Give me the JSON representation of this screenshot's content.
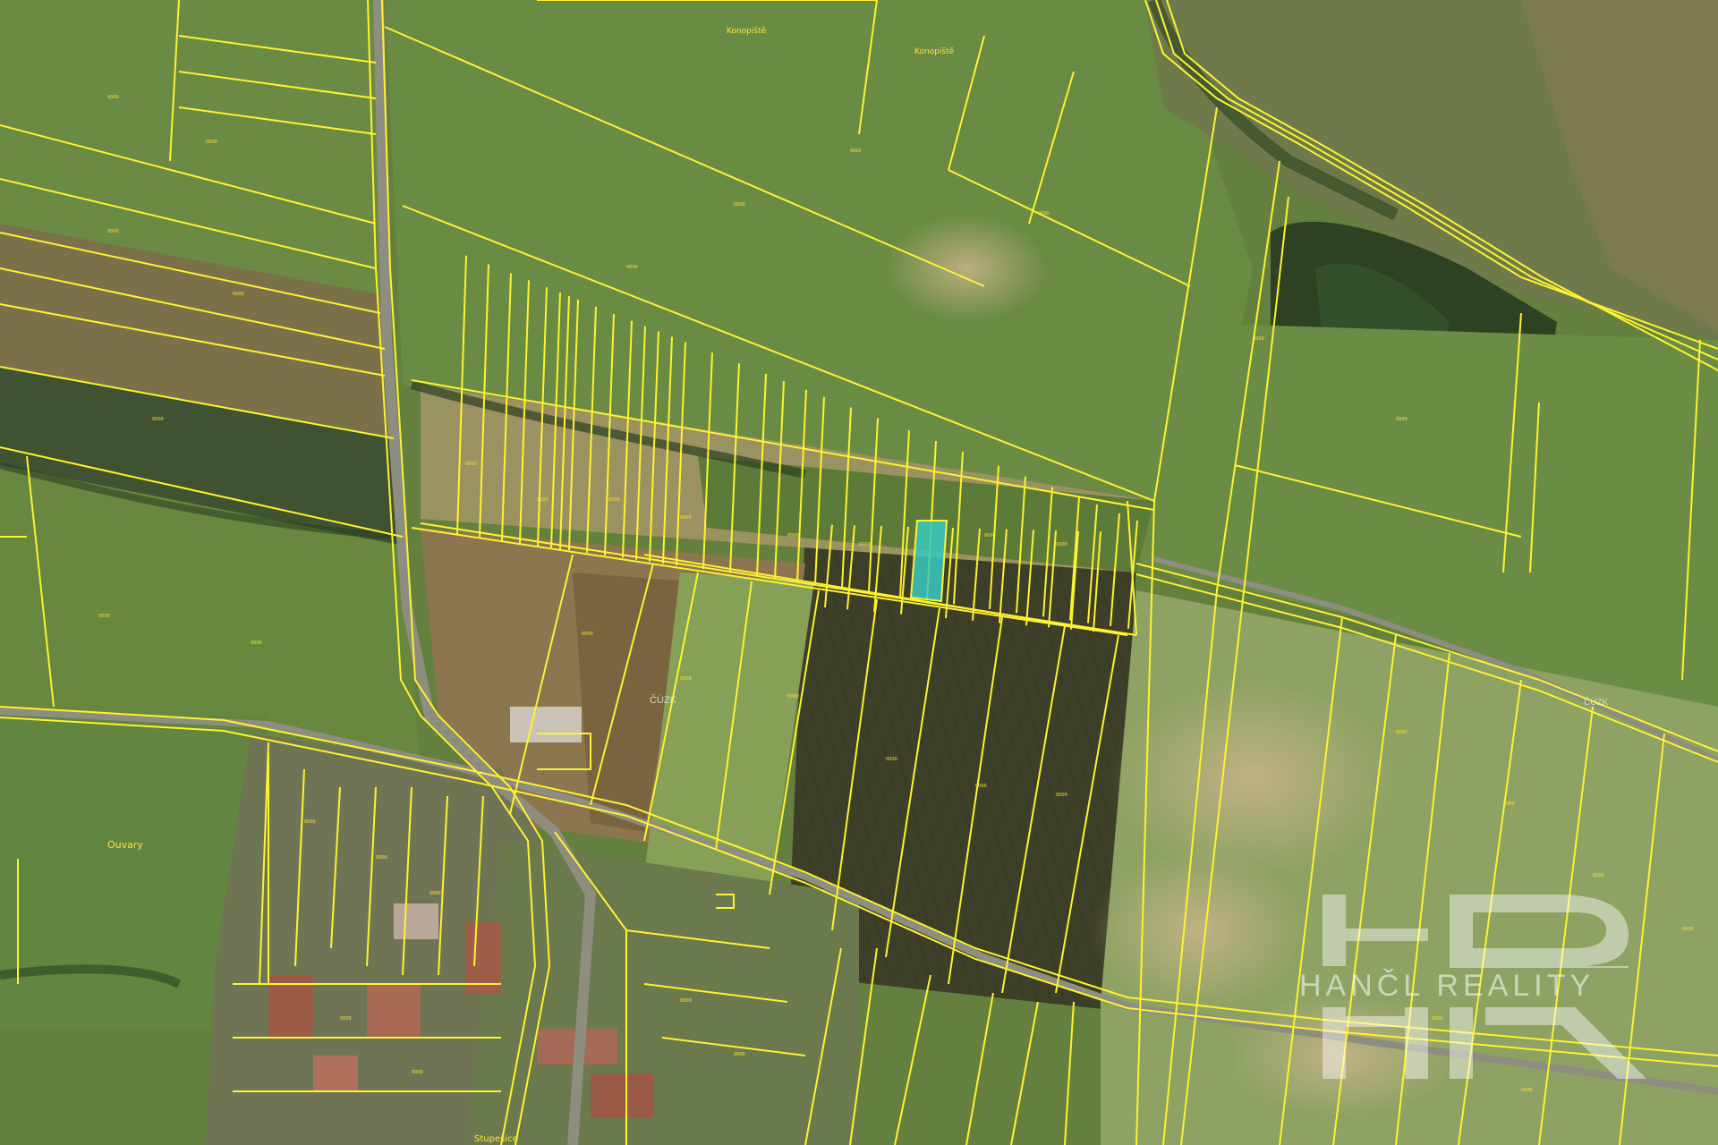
{
  "map": {
    "labels": {
      "konopiste_1": "Konopiště",
      "konopiste_2": "Konopiště",
      "ouvary": "Ouvary",
      "stupesice": "Stupešice",
      "cuzk_1": "ČÚZK",
      "cuzk_2": "ČÚZK"
    },
    "parcel_number_text": "0000",
    "highlighted_parcel": {
      "color": "#37c9c0"
    },
    "boundary_color": "#fff230"
  },
  "watermark": {
    "text": "HANČL REALITY",
    "monogram": "HR",
    "opacity": 0.55,
    "color": "#ffffff"
  }
}
